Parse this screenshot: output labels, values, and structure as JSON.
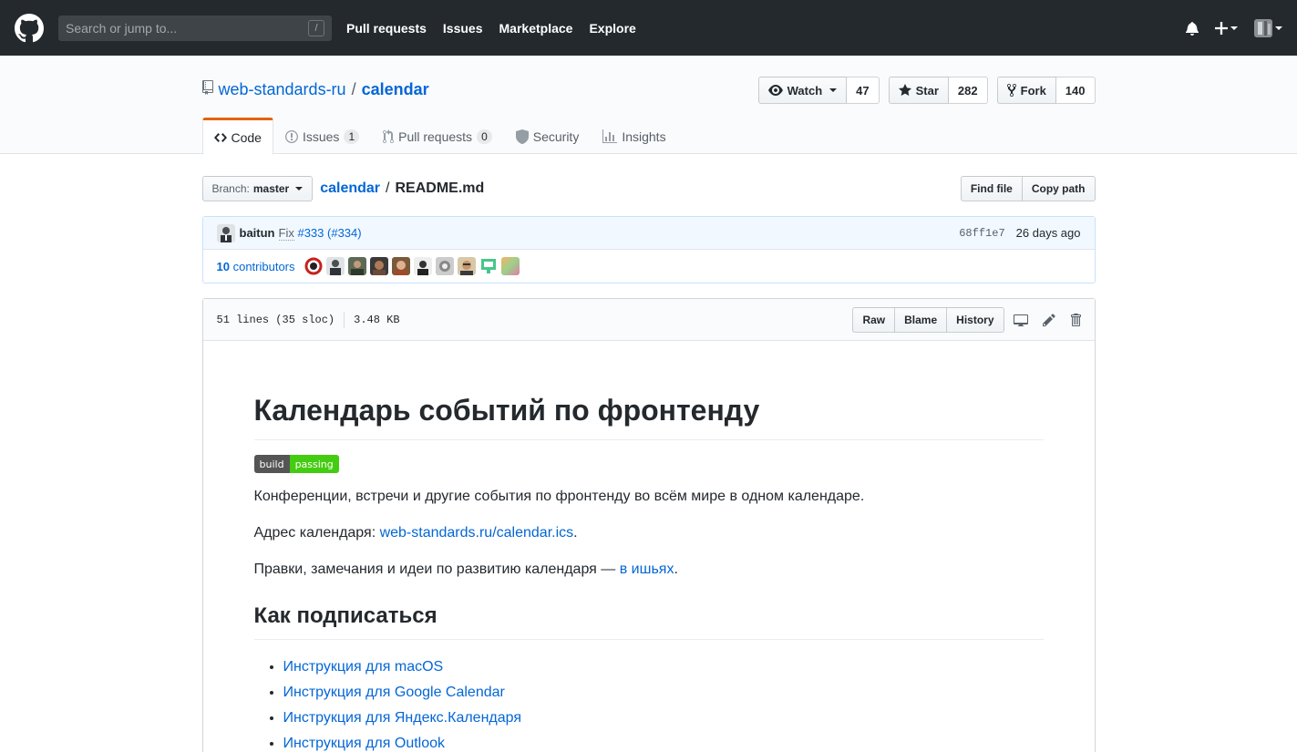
{
  "header": {
    "search_placeholder": "Search or jump to...",
    "search_shortcut": "/",
    "nav": [
      "Pull requests",
      "Issues",
      "Marketplace",
      "Explore"
    ]
  },
  "repo": {
    "owner": "web-standards-ru",
    "separator": "/",
    "name": "calendar",
    "watch_label": "Watch",
    "watch_count": "47",
    "star_label": "Star",
    "star_count": "282",
    "fork_label": "Fork",
    "fork_count": "140"
  },
  "tabs": [
    {
      "label": "Code",
      "counter": ""
    },
    {
      "label": "Issues",
      "counter": "1"
    },
    {
      "label": "Pull requests",
      "counter": "0"
    },
    {
      "label": "Security",
      "counter": ""
    },
    {
      "label": "Insights",
      "counter": ""
    }
  ],
  "file_nav": {
    "branch_prefix": "Branch:",
    "branch": "master",
    "breadcrumb_root": "calendar",
    "breadcrumb_sep": "/",
    "file_name": "README.md",
    "find_file": "Find file",
    "copy_path": "Copy path"
  },
  "commit": {
    "author": "baitun",
    "message_prefix": "Fix",
    "issue_link": "#333",
    "pr_link": "(#334)",
    "sha": "68ff1e7",
    "time": "26 days ago",
    "contributors_count": "10",
    "contributors_label": "contributors"
  },
  "file": {
    "lines": "51 lines (35 sloc)",
    "size": "3.48 KB",
    "raw": "Raw",
    "blame": "Blame",
    "history": "History"
  },
  "readme": {
    "title": "Календарь событий по фронтенду",
    "badge_left": "build",
    "badge_right": "passing",
    "p1": "Конференции, встречи и другие события по фронтенду во всём мире в одном календаре.",
    "p2_prefix": "Адрес календаря: ",
    "p2_link": "web-standards.ru/calendar.ics",
    "p2_suffix": ".",
    "p3_prefix": "Правки, замечания и идеи по развитию календаря — ",
    "p3_link": "в ишьях",
    "p3_suffix": ".",
    "h2": "Как подписаться",
    "list": [
      "Инструкция для macOS",
      "Инструкция для Google Calendar",
      "Инструкция для Яндекс.Календаря",
      "Инструкция для Outlook"
    ]
  },
  "colors": {
    "header_bg": "#24292e",
    "link": "#0366d6",
    "tab_accent": "#e36209",
    "badge_green": "#44cc11"
  }
}
